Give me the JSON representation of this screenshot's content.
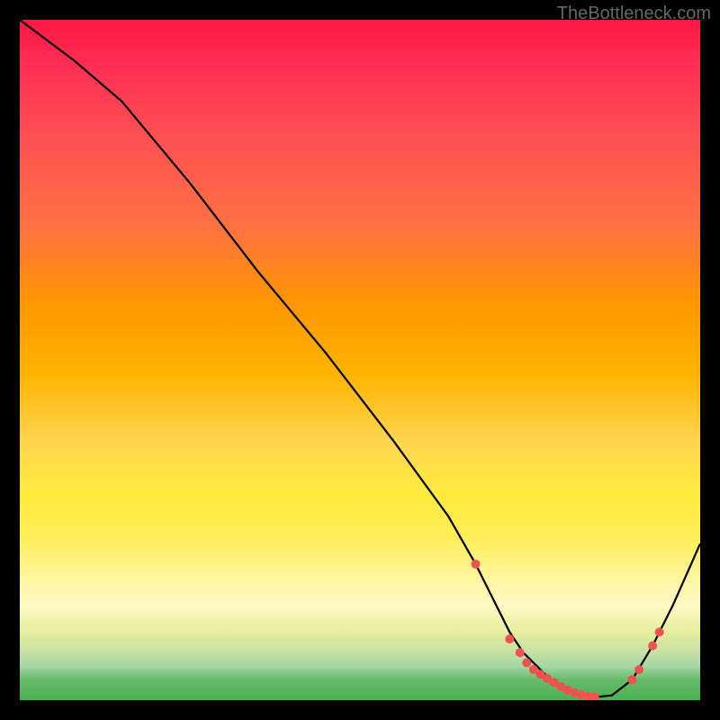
{
  "watermark": "TheBottleneck.com",
  "chart_data": {
    "type": "line",
    "title": "",
    "xlabel": "",
    "ylabel": "",
    "xlim": [
      0,
      100
    ],
    "ylim": [
      0,
      100
    ],
    "series": [
      {
        "name": "curve",
        "x": [
          0,
          8,
          15,
          25,
          35,
          45,
          55,
          63,
          67,
          70,
          72,
          74,
          76,
          78,
          80,
          82,
          84,
          85,
          87,
          90,
          93,
          96,
          100
        ],
        "values": [
          100,
          94,
          88,
          76,
          63,
          51,
          38,
          27,
          20,
          14,
          10,
          7,
          5,
          3,
          1.5,
          0.8,
          0.5,
          0.5,
          0.7,
          3,
          8,
          14,
          23
        ]
      }
    ],
    "markers": {
      "name": "dots",
      "x": [
        67,
        72,
        73.5,
        74.5,
        75.5,
        76.5,
        77.5,
        78.5,
        79.5,
        80.5,
        81.5,
        82.5,
        83.5,
        84.5,
        90,
        91,
        93,
        94
      ],
      "values": [
        20,
        9,
        7,
        5.5,
        4.5,
        3.8,
        3.2,
        2.6,
        2.0,
        1.5,
        1.1,
        0.8,
        0.6,
        0.5,
        3,
        4.5,
        8,
        10
      ]
    },
    "gradient_stops": [
      {
        "pos": 0,
        "color": "#ff1744"
      },
      {
        "pos": 50,
        "color": "#ffb300"
      },
      {
        "pos": 80,
        "color": "#fff59d"
      },
      {
        "pos": 100,
        "color": "#4caf50"
      }
    ]
  }
}
